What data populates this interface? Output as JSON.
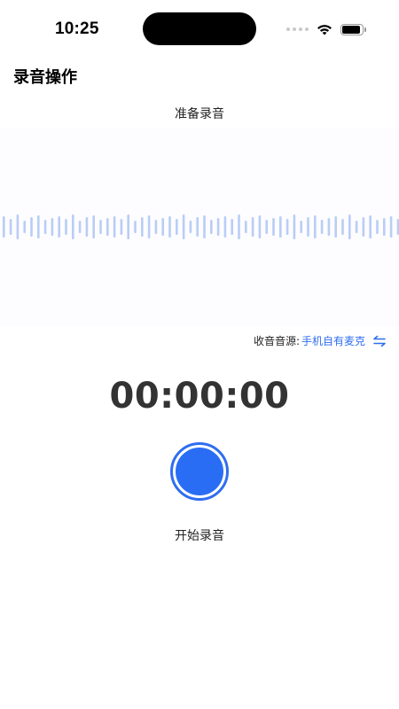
{
  "status_bar": {
    "time": "10:25",
    "icons": [
      "signal-dots-icon",
      "wifi-icon",
      "battery-icon"
    ],
    "battery_level": 0.9
  },
  "header": {
    "title": "录音操作"
  },
  "recorder": {
    "status": "准备录音",
    "source_label": "收音音源:",
    "source_value": "手机自有麦克",
    "switch_icon": "swap-arrows-icon",
    "timer": "00:00:00",
    "button_label": "开始录音"
  },
  "colors": {
    "accent": "#2f6ef0",
    "wave": "#b9cdf6",
    "wave_background": "#fdfcfe",
    "timer_text": "#333333"
  }
}
